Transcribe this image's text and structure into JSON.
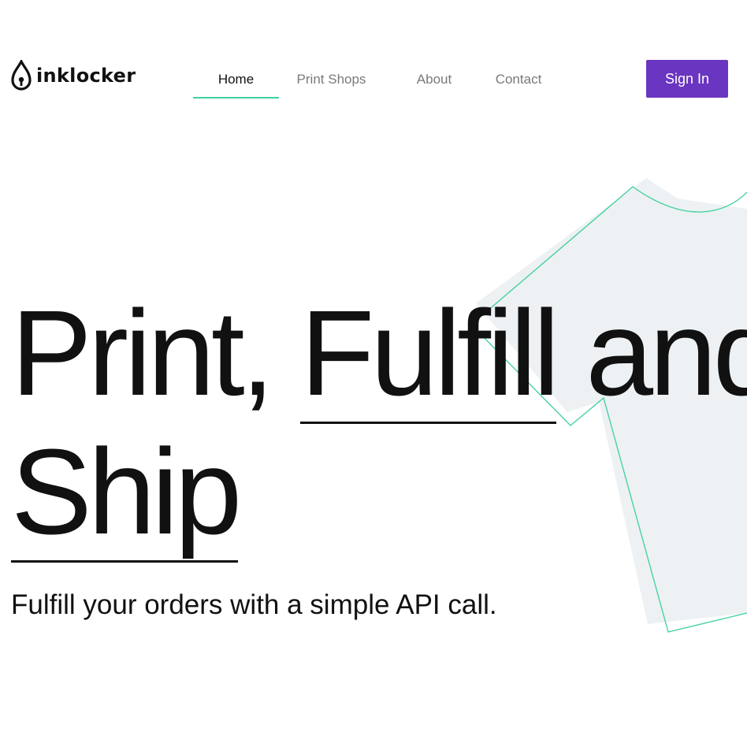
{
  "header": {
    "brand": "inklocker",
    "nav": [
      {
        "label": "Home",
        "active": true
      },
      {
        "label": "Print Shops",
        "active": false
      },
      {
        "label": "About",
        "active": false
      },
      {
        "label": "Contact",
        "active": false
      }
    ],
    "sign_in_label": "Sign In"
  },
  "hero": {
    "headline_line1": [
      "Print,",
      "Fulfill",
      "and"
    ],
    "headline_line2": [
      "Ship"
    ],
    "tagline": "Fulfill your orders with a simple API call.",
    "illustration": "t-shirt"
  },
  "colors": {
    "accent": "#3ecf9e",
    "brand_button": "#6a35c0",
    "shirt_fill": "#edf1f3",
    "text": "#111111",
    "nav_inactive": "#7a7a7a"
  },
  "icons": {
    "logo": "ink-drop-lock-icon"
  }
}
